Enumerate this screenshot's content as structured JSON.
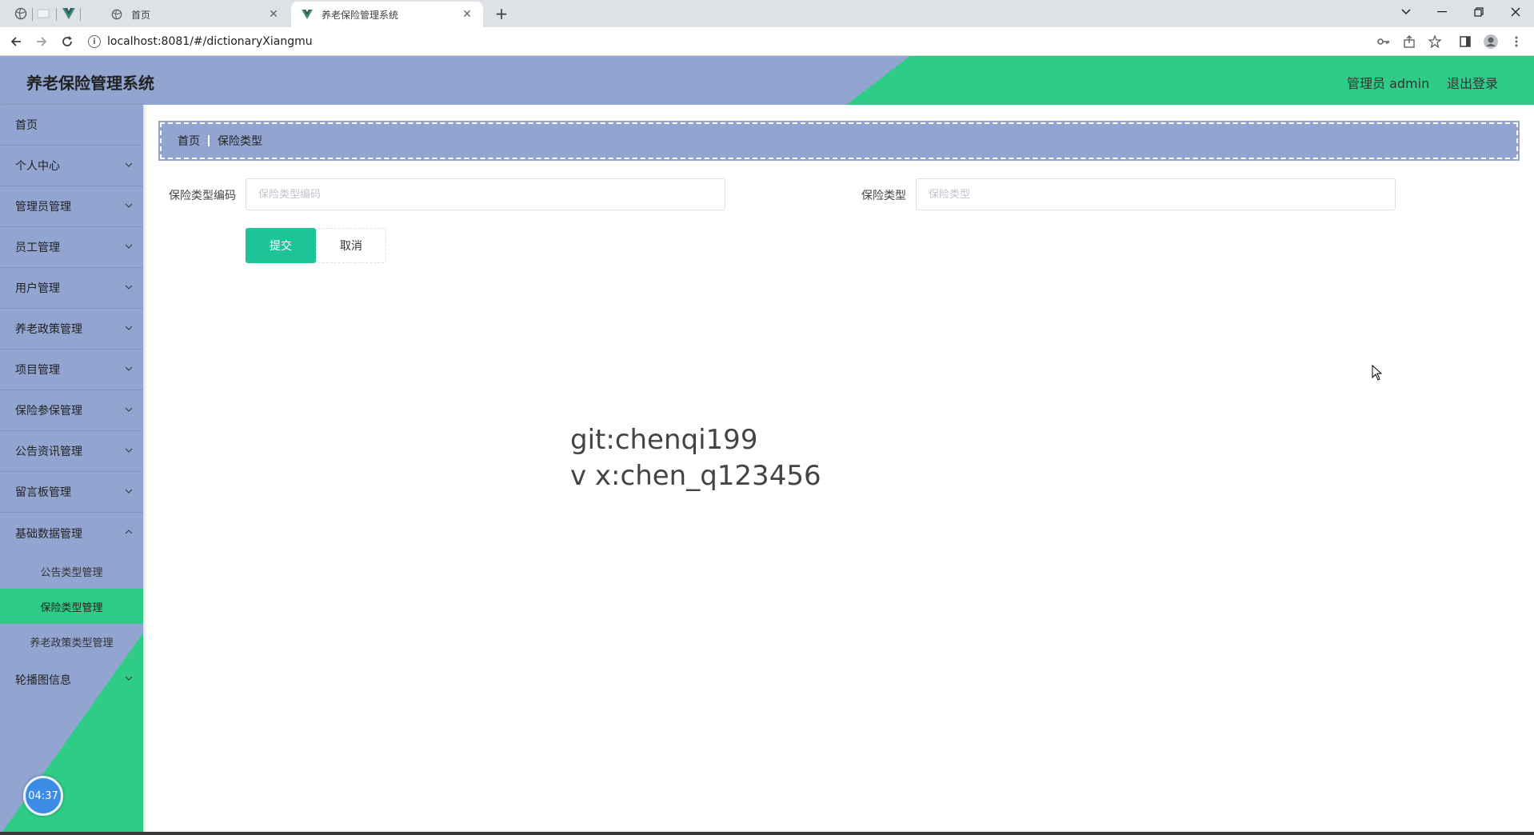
{
  "browser": {
    "tabs": [
      {
        "title": "首页",
        "active": false
      },
      {
        "title": "养老保险管理系统",
        "active": true
      }
    ],
    "url": "localhost:8081/#/dictionaryXiangmu"
  },
  "header": {
    "title": "养老保险管理系统",
    "user": "管理员 admin",
    "logout": "退出登录"
  },
  "sidebar": {
    "items": [
      {
        "label": "首页",
        "has_children": false
      },
      {
        "label": "个人中心",
        "has_children": true
      },
      {
        "label": "管理员管理",
        "has_children": true
      },
      {
        "label": "员工管理",
        "has_children": true
      },
      {
        "label": "用户管理",
        "has_children": true
      },
      {
        "label": "养老政策管理",
        "has_children": true
      },
      {
        "label": "项目管理",
        "has_children": true
      },
      {
        "label": "保险参保管理",
        "has_children": true
      },
      {
        "label": "公告资讯管理",
        "has_children": true
      },
      {
        "label": "留言板管理",
        "has_children": true
      },
      {
        "label": "基础数据管理",
        "has_children": true,
        "expanded": true
      },
      {
        "label": "轮播图信息",
        "has_children": true
      }
    ],
    "submenu": [
      {
        "label": "公告类型管理",
        "active": false
      },
      {
        "label": "保险类型管理",
        "active": true
      },
      {
        "label": "养老政策类型管理",
        "active": false
      }
    ],
    "clock": "04:37"
  },
  "breadcrumb": {
    "home": "首页",
    "current": "保险类型"
  },
  "form": {
    "code_label": "保险类型编码",
    "code_placeholder": "保险类型编码",
    "code_value": "",
    "type_label": "保险类型",
    "type_placeholder": "保险类型",
    "type_value": "",
    "submit": "提交",
    "cancel": "取消"
  },
  "watermark": {
    "line1": "git:chenqi199",
    "line2": "v x:chen_q123456"
  },
  "colors": {
    "sidebar_bg": "#92a5d1",
    "accent_green": "#2fcc88",
    "submit_green": "#1dc497"
  }
}
